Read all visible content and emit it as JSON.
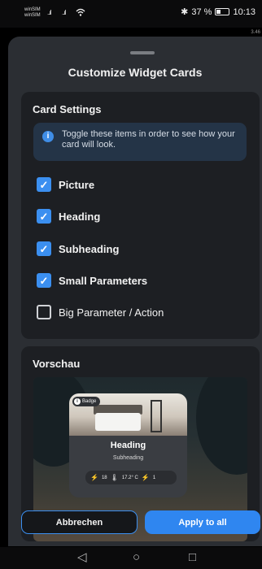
{
  "status_bar": {
    "carrier_1": "winSIM",
    "carrier_2": "winSIM",
    "signal_1": "..ıl",
    "signal_2": "..ıl",
    "wifi_icon": "wifi-icon",
    "bluetooth": "✱",
    "battery_percent": "37 %",
    "battery_level": 0.37,
    "time": "10:13",
    "tiny_right_text": "3.46"
  },
  "sheet": {
    "title": "Customize Widget Cards"
  },
  "card_settings": {
    "title": "Card Settings",
    "info_text": "Toggle these items in order to see how your card will look.",
    "options": [
      {
        "label": "Picture",
        "checked": true
      },
      {
        "label": "Heading",
        "checked": true
      },
      {
        "label": "Subheading",
        "checked": true
      },
      {
        "label": "Small Parameters",
        "checked": true
      },
      {
        "label": "Big Parameter / Action",
        "checked": false
      }
    ]
  },
  "preview": {
    "title": "Vorschau",
    "widget": {
      "badge": "Badge",
      "heading": "Heading",
      "subheading": "Subheading",
      "params": [
        "18",
        "17.2° C",
        "1"
      ]
    }
  },
  "actions": {
    "cancel_label": "Abbrechen",
    "apply_label": "Apply to all"
  },
  "nav": {
    "back": "◁",
    "home": "○",
    "recents": "□"
  },
  "colors": {
    "accent": "#3b8ff0",
    "sheet_bg": "#2b2e33",
    "card_bg": "#1d1f23",
    "info_bg": "#243447"
  }
}
